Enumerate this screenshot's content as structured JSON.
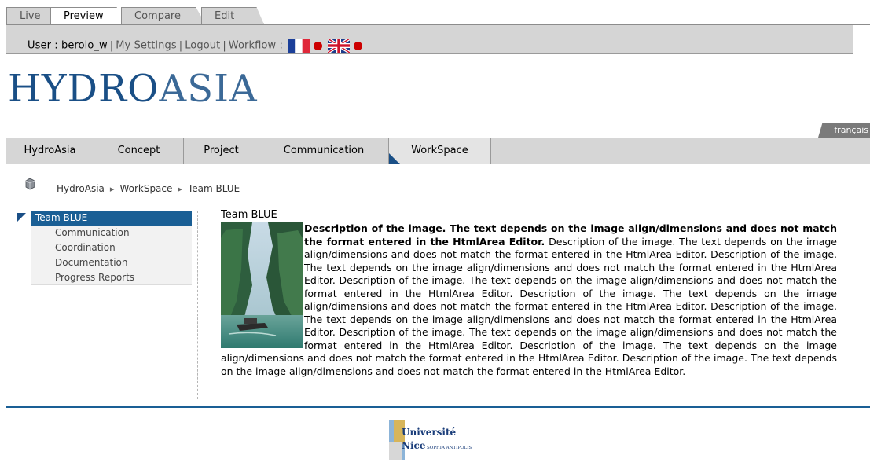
{
  "mode_tabs": [
    {
      "label": "Live",
      "active": false
    },
    {
      "label": "Preview",
      "active": true
    },
    {
      "label": "Compare",
      "active": false
    },
    {
      "label": "Edit",
      "active": false
    }
  ],
  "user_bar": {
    "user_label": "User : ",
    "username": "berolo_w",
    "my_settings": "My Settings",
    "logout": "Logout",
    "workflow": "Workflow :",
    "flags": [
      "french-flag-icon",
      "uk-flag-icon"
    ],
    "dot_color": "#cc0000"
  },
  "logo": {
    "part1": "HYDRO",
    "part2": "ASIA"
  },
  "language_tab": "français",
  "nav_tabs": [
    {
      "label": "HydroAsia",
      "active": false
    },
    {
      "label": "Concept",
      "active": false
    },
    {
      "label": "Project",
      "active": false
    },
    {
      "label": "Communication",
      "active": false
    },
    {
      "label": "WorkSpace",
      "active": true
    }
  ],
  "breadcrumb": [
    "HydroAsia",
    "WorkSpace",
    "Team BLUE"
  ],
  "sidebar": {
    "active": "Team BLUE",
    "items": [
      "Communication",
      "Coordination",
      "Documentation",
      "Progress Reports"
    ]
  },
  "content": {
    "title": "Team BLUE",
    "bold_intro": "Description of the image. The text depends on the image align/dimensions and does not match the format entered in the HtmlArea Editor.",
    "body": "Description of the image. The text depends on the image align/dimensions and does not match the format entered in the HtmlArea Editor. Description of the image. The text depends on the image align/dimensions and does not match the format entered in the HtmlArea Editor. Description of the image. The text depends on the image align/dimensions and does not match the format entered in the HtmlArea Editor. Description of the image. The text depends on the image align/dimensions and does not match the format entered in the HtmlArea Editor. Description of the image. The text depends on the image align/dimensions and does not match the format entered in the HtmlArea Editor. Description of the image. The text depends on the image align/dimensions and does not match the format entered in the HtmlArea Editor. Description of the image. The text depends on the image align/dimensions and does not match the format entered in the HtmlArea Editor. Description of the image. The text depends on the image align/dimensions and does not match the format entered in the HtmlArea Editor."
  },
  "footer": {
    "logo_line1": "Université",
    "logo_line2": "Nice",
    "logo_line3": "SOPHIA ANTIPOLIS"
  },
  "colors": {
    "accent": "#1a5f95",
    "logo_blue": "#1a4f86"
  }
}
